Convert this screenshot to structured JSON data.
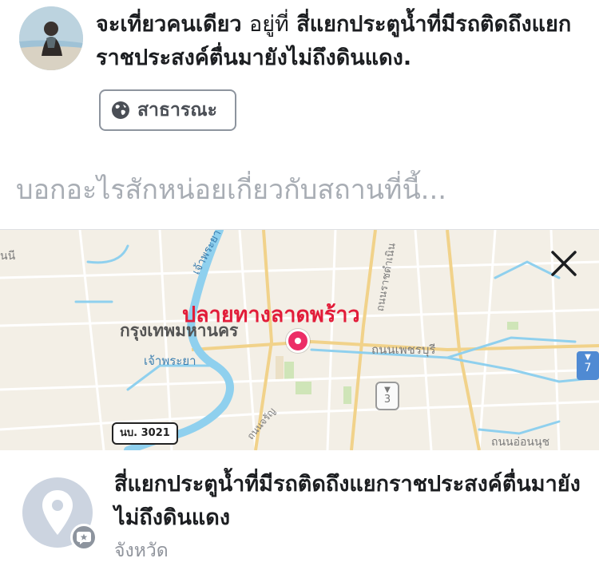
{
  "post": {
    "author_line": "จะเที่ยวคนเดียว",
    "location_connector": "อยู่ที่",
    "location_name": "สี่แยกประตูน้ำที่มีรถติดถึงแยกราชประสงค์ตื่นมายังไม่ถึงดินแดง."
  },
  "privacy": {
    "icon": "globe-icon",
    "label": "สาธารณะ"
  },
  "composer": {
    "placeholder": "บอกอะไรสักหน่อยเกี่ยวกับสถานที่นี้..."
  },
  "map": {
    "pin_label": "ปลายทางลาดพร้าว",
    "district_label": "กรุงเทพมหานคร",
    "river_label_1": "เจ้าพระยา",
    "river_label_2": "เจ้าพระยา",
    "road_label_1": "ถนนเพชรบุรี",
    "road_label_2": "ถนนราชดำเนิน",
    "road_label_3": "ถนนอ่อนนุช",
    "road_label_4": "ถนนจรัญ",
    "edge_label": "นนี",
    "route_badge": "นบ. 3021",
    "shield_number": "3",
    "shield2_number": "7",
    "close_icon": "close-icon"
  },
  "place": {
    "name": "สี่แยกประตูน้ำที่มีรถติดถึงแยกราชประสงค์ตื่นมายังไม่ถึงดินแดง",
    "category": "จังหวัด",
    "icon": "map-pin-icon",
    "badge_icon": "star-badge-icon"
  },
  "colors": {
    "pin": "#ec2d66",
    "pin_label": "#e21d3a",
    "map_land": "#f3efe6",
    "water": "#8fd0ee",
    "text_primary": "#1c1e21",
    "text_secondary": "#90949c"
  }
}
